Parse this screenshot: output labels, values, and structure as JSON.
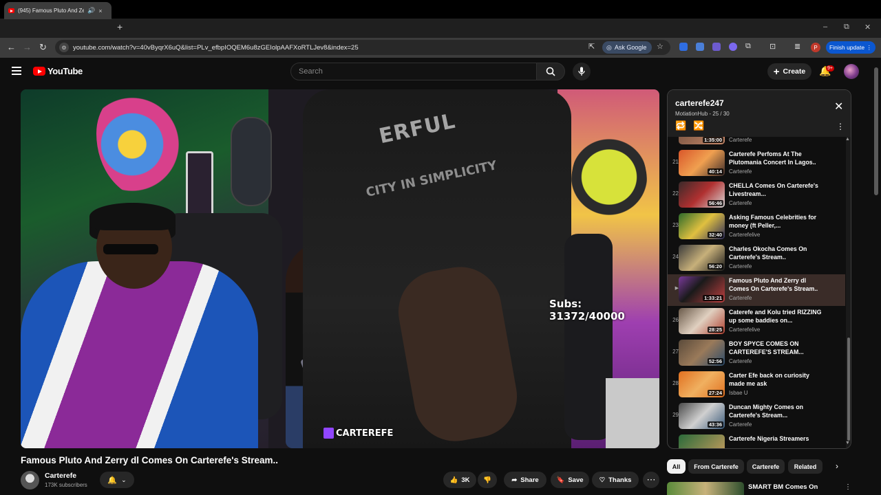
{
  "browser": {
    "tab_title": "(945) Famous Pluto And Ze",
    "tab_audio_icon": "speaker-icon",
    "tab_close": "×",
    "new_tab": "+",
    "url": "youtube.com/watch?v=40vByqrX6uQ&list=PLv_efbpIOQEM6u8zGEIolpAAFXoRTLJev8&index=25",
    "ask_google": "Ask Google",
    "finish_update": "Finish update",
    "profile_initial": "P",
    "win_min": "–",
    "win_max": "⧉",
    "win_close": "✕"
  },
  "header": {
    "logo_text": "YouTube",
    "search_placeholder": "Search",
    "create_label": "Create",
    "notif_count": "9+"
  },
  "video": {
    "subs_counter": "Subs: 31372/40000",
    "stream_tag": "CARTEREFE",
    "shirt_text": "ERFUL",
    "shirt_text2": "CITY IN SIMPLICITY"
  },
  "below": {
    "title": "Famous Pluto And Zerry dl Comes On Carterefe's Stream..",
    "channel": "Carterefe",
    "subscribers": "173K subscribers",
    "like_count": "3K",
    "share": "Share",
    "save": "Save",
    "thanks": "Thanks"
  },
  "playlist": {
    "title": "carterefe247",
    "subtitle": "MotiationHub - 25 / 30",
    "partial_top": {
      "duration": "1:35:00",
      "channel": "Carterefe"
    },
    "items": [
      {
        "num": "21",
        "title": "Carterefe Perfoms At The Plutomania Concert In Lagos..",
        "channel": "Carterefe",
        "duration": "40:14",
        "active": false
      },
      {
        "num": "22",
        "title": "CHELLA Comes On Carterefe's Livestream...",
        "channel": "Carterefe",
        "duration": "56:46",
        "active": false
      },
      {
        "num": "23",
        "title": "Asking Famous Celebrities for money (ft Peller,...",
        "channel": "Carterefelive",
        "duration": "32:40",
        "active": false
      },
      {
        "num": "24",
        "title": "Charles Okocha Comes On Carterefe's Stream..",
        "channel": "Carterefe",
        "duration": "56:20",
        "active": false
      },
      {
        "num": "▶",
        "title": "Famous Pluto And Zerry dl Comes On Carterefe's Stream..",
        "channel": "Carterefe",
        "duration": "1:33:21",
        "active": true
      },
      {
        "num": "26",
        "title": "Caterefe and Kolu tried RIZZING up some baddies on...",
        "channel": "Carterefelive",
        "duration": "28:25",
        "active": false
      },
      {
        "num": "27",
        "title": "BOY SPYCE COMES ON CARTEREFE'S STREAM...",
        "channel": "Carterefe",
        "duration": "52:56",
        "active": false
      },
      {
        "num": "28",
        "title": "Carter Efe back on curiosity made me ask",
        "channel": "Isbae U",
        "duration": "27:24",
        "active": false
      },
      {
        "num": "29",
        "title": "Duncan Mighty Comes on Carterefe's Stream...",
        "channel": "Carterefe",
        "duration": "43:36",
        "active": false
      },
      {
        "num": "",
        "title": "Carterefe Nigeria Streamers",
        "channel": "",
        "duration": "",
        "active": false
      }
    ]
  },
  "chips": [
    "All",
    "From Carterefe",
    "Carterefe",
    "Related"
  ],
  "recommended": {
    "title": "SMART BM Comes On"
  },
  "colors": {
    "accent_red": "#ff0000",
    "active_item_bg": "#3a2c28",
    "finish_update_blue": "#0b57d0"
  }
}
